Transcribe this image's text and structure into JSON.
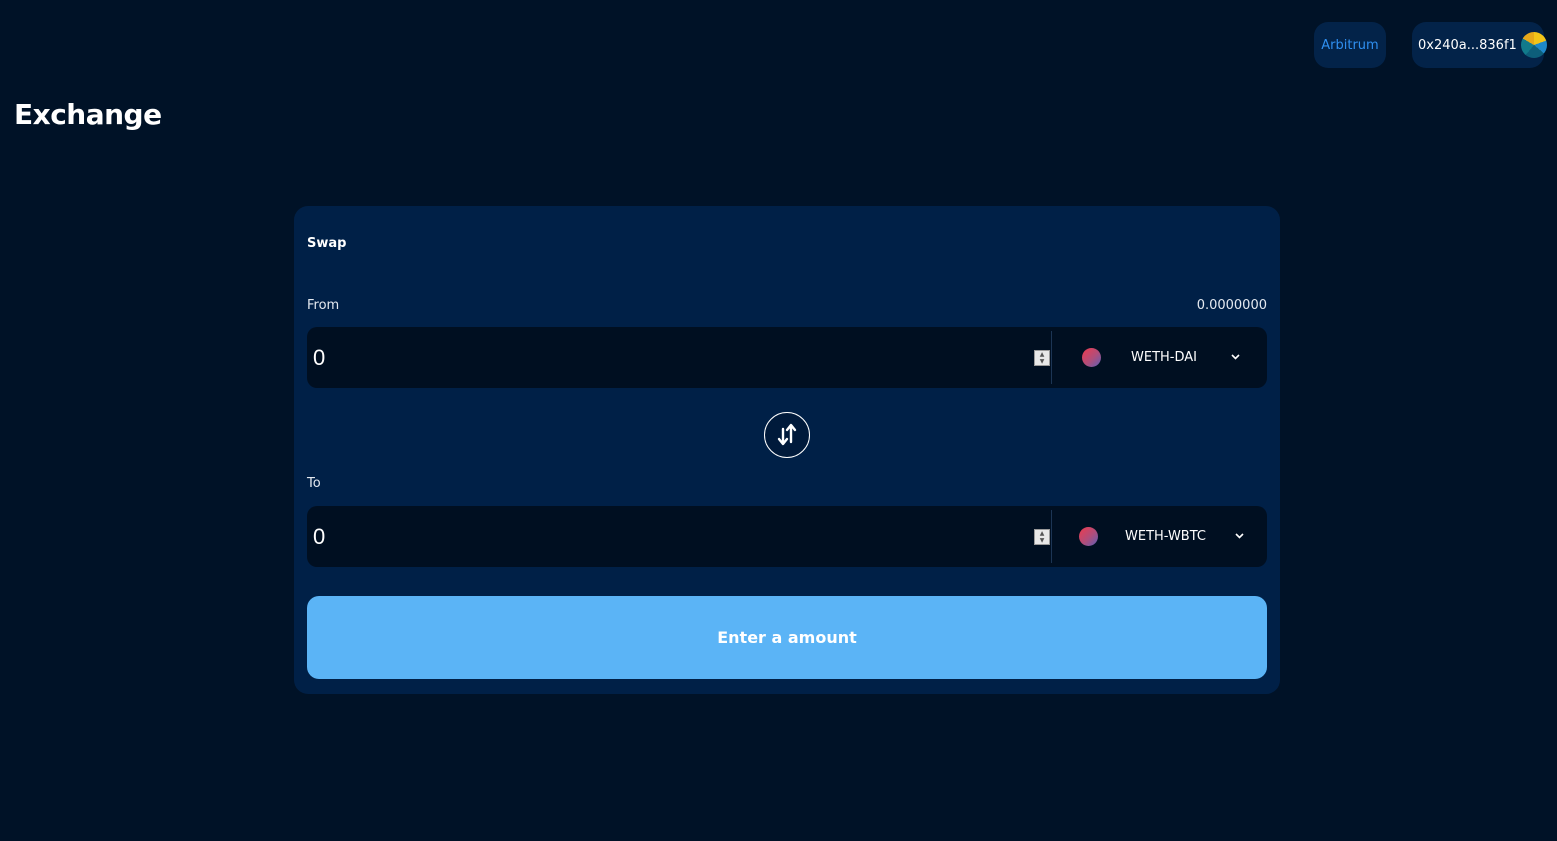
{
  "header": {
    "network_label": "Arbitrum",
    "wallet_address": "0x240a...836f1",
    "page_title": "Exchange"
  },
  "swap": {
    "title": "Swap",
    "from": {
      "label": "From",
      "balance": "0.0000000",
      "amount": "0",
      "token": "WETH-DAI"
    },
    "to": {
      "label": "To",
      "amount": "0",
      "token": "WETH-WBTC"
    },
    "submit_label": "Enter a amount"
  },
  "colors": {
    "background": "#001227",
    "card": "#002047",
    "input": "#000f21",
    "accent": "#5bb4f6",
    "network_text": "#2f8ff0"
  },
  "icons": {
    "toggle": "swap-vertical-arrows-icon",
    "dropdown": "chevron-down-icon",
    "token": "token-logo-icon"
  }
}
